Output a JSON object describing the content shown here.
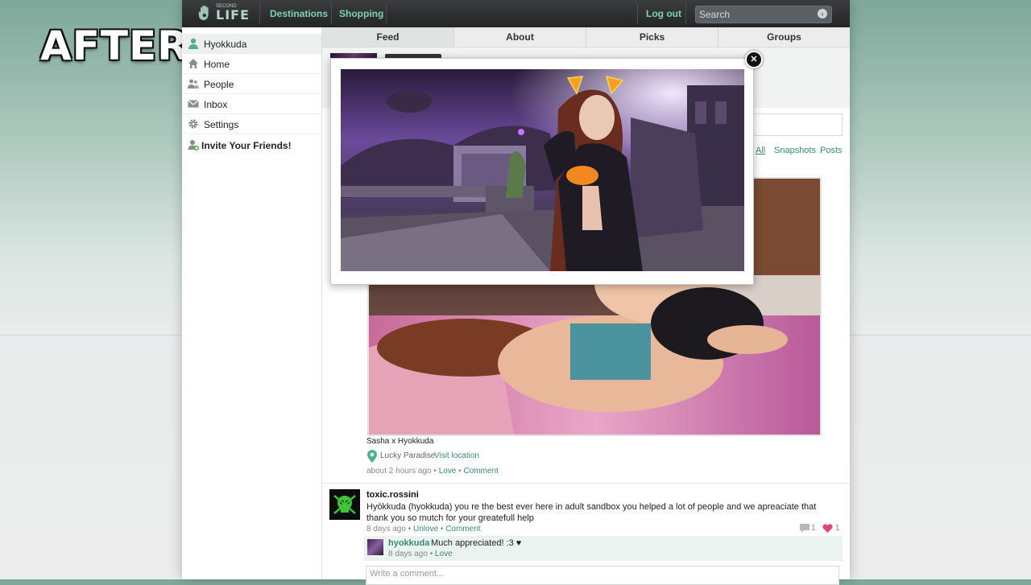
{
  "overlay_label": "AFTER",
  "topbar": {
    "logo_small": "SECOND",
    "logo_text": "LIFE",
    "nav": [
      "Destinations",
      "Shopping"
    ],
    "logout": "Log out",
    "search_placeholder": "Search"
  },
  "sidebar": {
    "items": [
      {
        "label": "Hyokkuda",
        "icon": "person-icon"
      },
      {
        "label": "Home",
        "icon": "home-icon"
      },
      {
        "label": "People",
        "icon": "people-icon"
      },
      {
        "label": "Inbox",
        "icon": "envelope-icon"
      },
      {
        "label": "Settings",
        "icon": "gear-icon"
      },
      {
        "label": "Invite Your Friends!",
        "icon": "add-person-icon"
      }
    ]
  },
  "tabs": [
    "Feed",
    "About",
    "Picks",
    "Groups"
  ],
  "filters": [
    "All",
    "Snapshots",
    "Posts"
  ],
  "post": {
    "caption": "Sasha x Hyokkuda",
    "location": "Lucky Paradise",
    "visit_location": "Visit location",
    "time": "about 2 hours ago",
    "love": "Love",
    "comment": "Comment"
  },
  "comment": {
    "user": "toxic.rossini",
    "text": "Hyōkkuda (hyokkuda) you re the best ever here in adult sandbox you helped a lot of people and we apreaciate that thank you so mutch for your greatefull help",
    "time": "8 days ago",
    "unlove": "Unlove",
    "comment": "Comment",
    "comment_count": "1",
    "love_count": "1"
  },
  "reply": {
    "user": "hyokkuda",
    "text": "Much appreciated! :3 ♥",
    "time": "8 days ago",
    "love": "Love"
  },
  "write_comment_placeholder": "Write a comment...",
  "colors": {
    "accent": "#3a8a78",
    "nav_accent": "#7fd0b0",
    "love_heart": "#e0457b"
  }
}
